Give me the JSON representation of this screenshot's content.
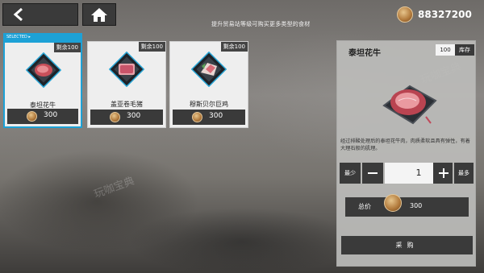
{
  "hint": "提升贸易站等级可购买更多类型的食材",
  "currency": {
    "icon": "coin-icon",
    "amount": "88327200"
  },
  "items": [
    {
      "name": "泰坦花牛",
      "remaining": "剩余100",
      "price": "300",
      "selected": true,
      "selected_label": "SELECTED ▸"
    },
    {
      "name": "盖亚卷毛猪",
      "remaining": "剩余100",
      "price": "300",
      "selected": false
    },
    {
      "name": "穆斯贝尔巨鸡",
      "remaining": "剩余100",
      "price": "300",
      "selected": false
    }
  ],
  "detail": {
    "title": "泰坦花牛",
    "stock_value": "100",
    "stock_label": "库存",
    "description": "经过排酸处理后的泰坦花牛肉，肉质柔软且具有弹性，有着大理石般的肌理。",
    "min_label": "最少",
    "max_label": "最多",
    "quantity": "1",
    "total_label": "总价",
    "total_value": "300",
    "buy_label": "采购"
  },
  "watermark": "玩咖宝典",
  "colors": {
    "selected": "#1da1d6",
    "dark": "#3a3a3a",
    "card": "#eeeeee"
  }
}
